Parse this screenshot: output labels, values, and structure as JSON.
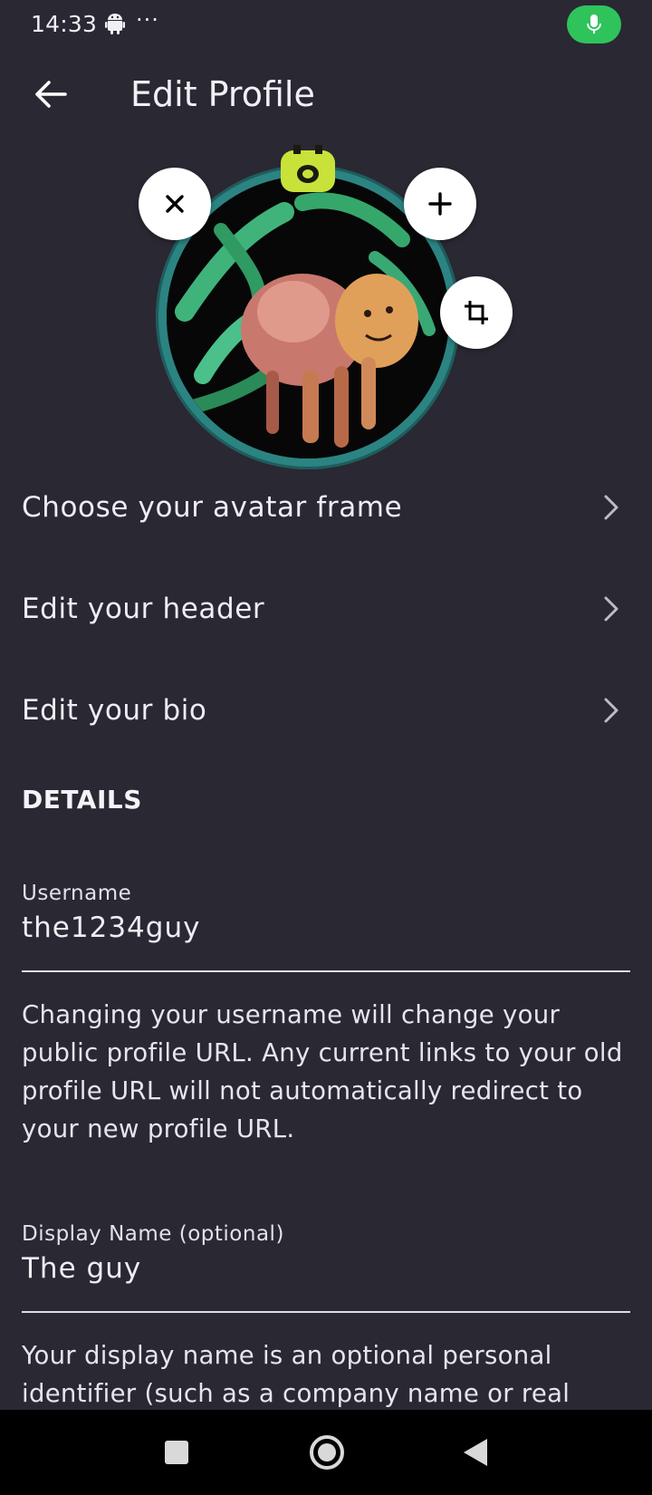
{
  "status_bar": {
    "time": "14:33",
    "more_indicator": "···",
    "icons": [
      "android-icon",
      "mic-icon"
    ],
    "mic_color": "#2fc35c"
  },
  "app_bar": {
    "title": "Edit Profile",
    "back_icon": "arrow-left-icon"
  },
  "avatar": {
    "remove_icon": "close-icon",
    "add_icon": "plus-icon",
    "crop_icon": "crop-icon",
    "frame_color": "#2e8f8d"
  },
  "menu": [
    {
      "label": "Choose your avatar frame"
    },
    {
      "label": "Edit your header"
    },
    {
      "label": "Edit your bio"
    }
  ],
  "details": {
    "heading": "DETAILS",
    "username": {
      "label": "Username",
      "value": "the1234guy",
      "help": "Changing your username will change your public profile URL. Any current links to your old profile URL will not automatically redirect to your new profile URL."
    },
    "display_name": {
      "label": "Display Name (optional)",
      "value": "The guy",
      "help": "Your display name is an optional personal identifier (such as a company name or real"
    }
  },
  "nav_bar": {
    "icons": [
      "square-icon",
      "home-circle-icon",
      "back-triangle-icon"
    ]
  },
  "colors": {
    "background": "#2a2832",
    "text": "#eeedf3",
    "accent_green": "#2fc35c"
  }
}
